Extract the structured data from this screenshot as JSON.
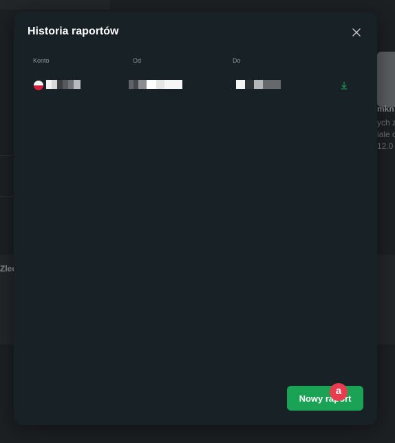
{
  "background": {
    "right_heading": "mkn",
    "right_lines": [
      "ych z",
      "iale c",
      "12.0"
    ],
    "left_label": "Zlec"
  },
  "modal": {
    "title": "Historia raportów",
    "close_icon": "close-icon",
    "columns": [
      "Konto",
      "Od",
      "Do"
    ],
    "rows": [
      {
        "account_flag": "poland-flag-icon",
        "account_value_visible": false,
        "from_value_visible": false,
        "to_value_visible": false,
        "action_icon": "download-icon"
      }
    ],
    "primary_button": "Nowy raport",
    "marker_label": "a"
  },
  "colors": {
    "modal_background": "#172126",
    "button_green": "#1aa354",
    "download_icon_green": "#1aa354",
    "marker_red": "#e83d4f",
    "page_background": "#1d2023"
  }
}
